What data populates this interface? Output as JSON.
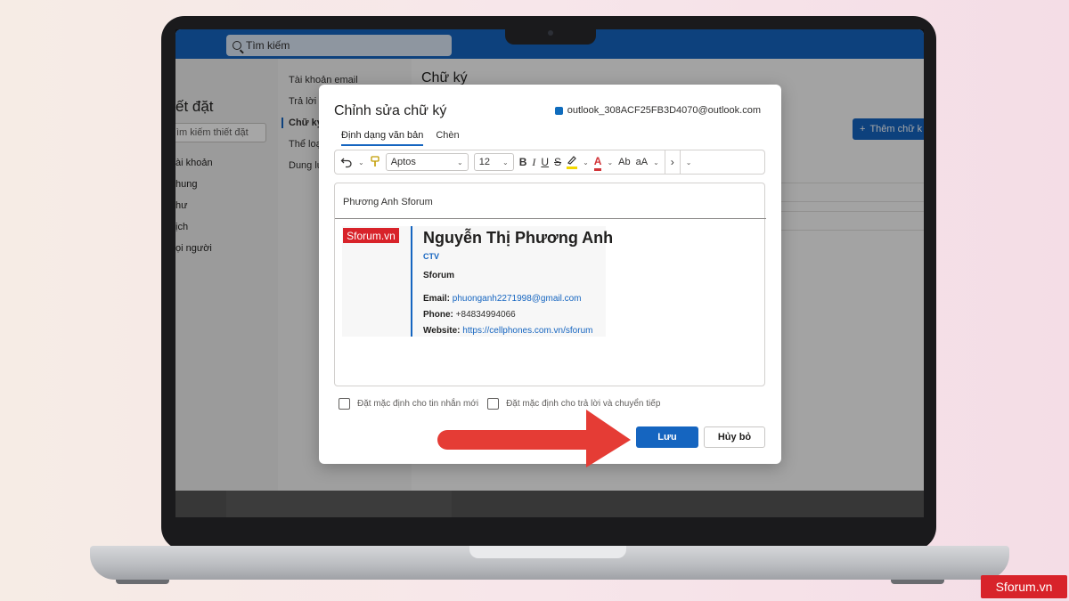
{
  "app": {
    "search_placeholder": "Tìm kiếm",
    "settings_title": "ết đặt",
    "settings_search_placeholder": "ìm kiếm thiết đặt",
    "nav_primary": [
      "ài khoản",
      "hung",
      "hư",
      "ịch",
      "ọi người"
    ],
    "nav_secondary": [
      "Tài khoản email",
      "Trả lời t",
      "Chữ ký",
      "Thể loạ",
      "Dung lư"
    ],
    "nav_secondary_active": "Chữ ký",
    "main_title": "Chữ ký",
    "add_signature_label": "Thêm chữ k",
    "accent_color": "#1565c0"
  },
  "dialog": {
    "title": "Chỉnh sửa chữ ký",
    "account_email": "outlook_308ACF25FB3D4070@outlook.com",
    "tabs": [
      {
        "label": "Định dạng văn bản",
        "active": true
      },
      {
        "label": "Chèn",
        "active": false
      }
    ],
    "toolbar": {
      "font": "Aptos",
      "size": "12",
      "bold": "B",
      "italic": "I",
      "underline": "U",
      "strike": "S",
      "highlight": "🖍",
      "font_color": "A",
      "case": "Ab",
      "size_toggle": "aA",
      "more": "›"
    },
    "editor": {
      "signature_name": "Phương Anh Sforum",
      "logo_text": "Sforum.vn",
      "person_name": "Nguyễn Thị Phương Anh",
      "role": "CTV",
      "company": "Sforum",
      "email_label": "Email:",
      "email_value": "phuonganh2271998@gmail.com",
      "phone_label": "Phone:",
      "phone_value": "+84834994066",
      "website_label": "Website:",
      "website_value": "https://cellphones.com.vn/sforum"
    },
    "checkboxes": [
      {
        "label": "Đặt mặc định cho tin nhắn mới",
        "checked": false
      },
      {
        "label": "Đặt mặc định cho trả lời và chuyển tiếp",
        "checked": false
      }
    ],
    "save_label": "Lưu",
    "cancel_label": "Hủy bỏ"
  },
  "watermark": "Sforum.vn",
  "colors": {
    "arrow": "#e53c35",
    "brand_red": "#d8232a"
  }
}
